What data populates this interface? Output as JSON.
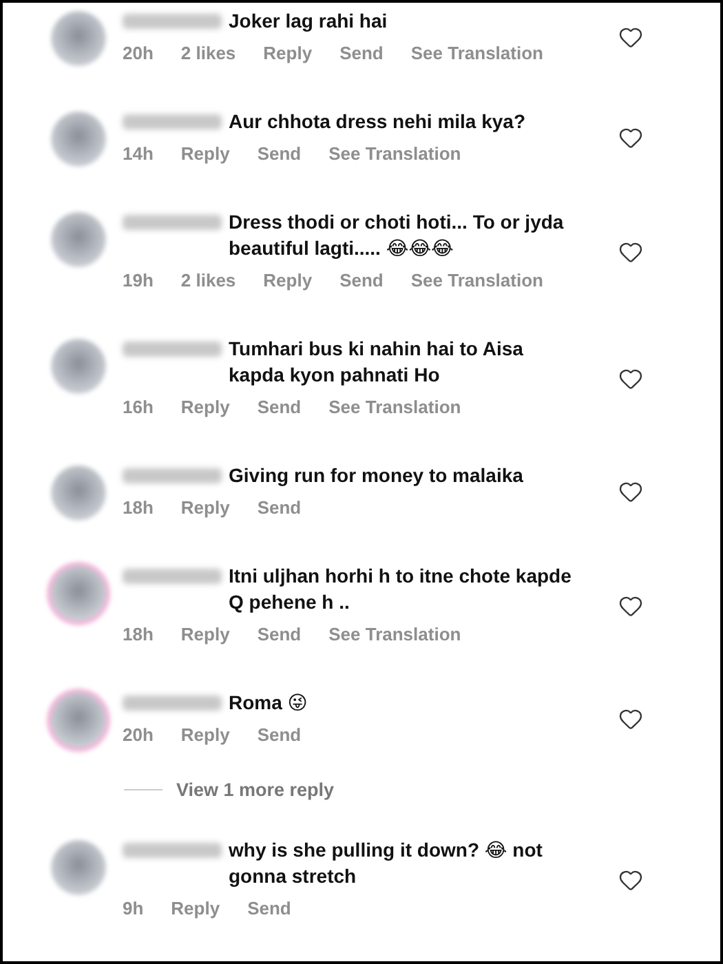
{
  "items": [
    {
      "kind": "comment",
      "story_ring": false,
      "text": "Joker lag rahi hai",
      "meta": [
        "20h",
        "2 likes",
        "Reply",
        "Send",
        "See Translation"
      ]
    },
    {
      "kind": "comment",
      "story_ring": false,
      "text": "Aur chhota dress nehi mila kya?",
      "meta": [
        "14h",
        "Reply",
        "Send",
        "See Translation"
      ]
    },
    {
      "kind": "comment",
      "story_ring": false,
      "text": "Dress thodi or choti hoti... To or jyda beautiful lagti..... 😂😂😂",
      "meta": [
        "19h",
        "2 likes",
        "Reply",
        "Send",
        "See Translation"
      ]
    },
    {
      "kind": "comment",
      "story_ring": false,
      "text": "Tumhari bus ki nahin hai to Aisa kapda kyon pahnati Ho",
      "meta": [
        "16h",
        "Reply",
        "Send",
        "See Translation"
      ]
    },
    {
      "kind": "comment",
      "story_ring": false,
      "text": "Giving run for money to malaika",
      "meta": [
        "18h",
        "Reply",
        "Send"
      ]
    },
    {
      "kind": "comment",
      "story_ring": true,
      "text": "Itni uljhan horhi h to itne chote kapde Q pehene h ..",
      "meta": [
        "18h",
        "Reply",
        "Send",
        "See Translation"
      ]
    },
    {
      "kind": "comment",
      "story_ring": true,
      "text": "Roma 😜",
      "meta": [
        "20h",
        "Reply",
        "Send"
      ]
    },
    {
      "kind": "view_more",
      "text": "View 1 more reply"
    },
    {
      "kind": "comment",
      "story_ring": false,
      "text": "why is she pulling it down? 😂 not gonna stretch",
      "meta": [
        "9h",
        "Reply",
        "Send"
      ]
    }
  ]
}
